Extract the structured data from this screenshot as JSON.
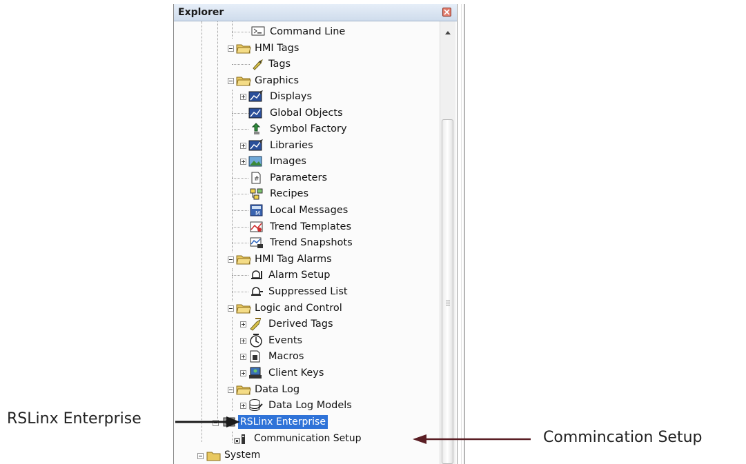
{
  "explorer": {
    "title": "Explorer",
    "items": [
      {
        "label": "Command Line",
        "icon": "command-line-icon"
      },
      {
        "label": "HMI Tags",
        "icon": "folder-icon"
      },
      {
        "label": "Tags",
        "icon": "tags-icon"
      },
      {
        "label": "Graphics",
        "icon": "folder-icon"
      },
      {
        "label": "Displays",
        "icon": "displays-icon"
      },
      {
        "label": "Global Objects",
        "icon": "global-objects-icon"
      },
      {
        "label": "Symbol Factory",
        "icon": "symbol-factory-icon"
      },
      {
        "label": "Libraries",
        "icon": "libraries-icon"
      },
      {
        "label": "Images",
        "icon": "images-icon"
      },
      {
        "label": "Parameters",
        "icon": "parameters-icon"
      },
      {
        "label": "Recipes",
        "icon": "recipes-icon"
      },
      {
        "label": "Local Messages",
        "icon": "local-messages-icon"
      },
      {
        "label": "Trend Templates",
        "icon": "trend-templates-icon"
      },
      {
        "label": "Trend Snapshots",
        "icon": "trend-snapshots-icon"
      },
      {
        "label": "HMI Tag Alarms",
        "icon": "folder-icon"
      },
      {
        "label": "Alarm Setup",
        "icon": "alarm-setup-icon"
      },
      {
        "label": "Suppressed List",
        "icon": "suppressed-list-icon"
      },
      {
        "label": "Logic and Control",
        "icon": "folder-icon"
      },
      {
        "label": "Derived Tags",
        "icon": "derived-tags-icon"
      },
      {
        "label": "Events",
        "icon": "events-icon"
      },
      {
        "label": "Macros",
        "icon": "macros-icon"
      },
      {
        "label": "Client Keys",
        "icon": "client-keys-icon"
      },
      {
        "label": "Data Log",
        "icon": "folder-icon"
      },
      {
        "label": "Data Log Models",
        "icon": "data-log-models-icon"
      },
      {
        "label": "RSLinx Enterprise",
        "icon": "rslinx-icon"
      },
      {
        "label": "Communication Setup",
        "icon": "communication-setup-icon"
      },
      {
        "label": "System",
        "icon": "folder-icon"
      }
    ]
  },
  "annotations": {
    "left": "RSLinx Enterprise",
    "right": "Commincation Setup"
  },
  "colors": {
    "selection": "#2f73d8",
    "folder": "#e8c860",
    "arrow_left": "#1a1a1a",
    "arrow_right": "#5a1e24"
  }
}
